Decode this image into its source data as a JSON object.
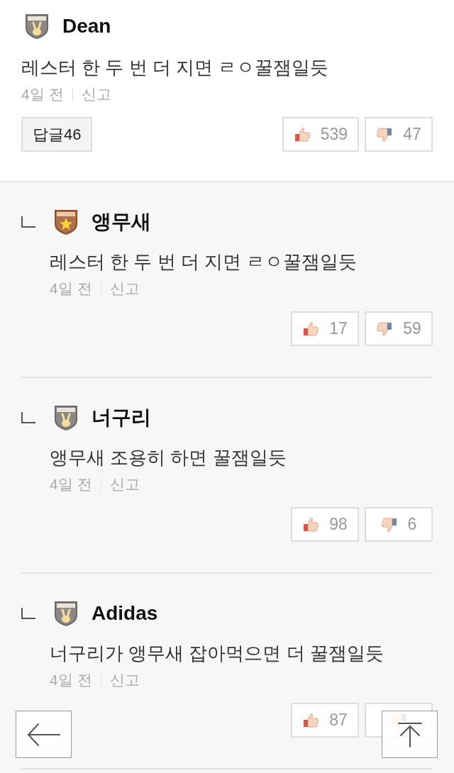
{
  "comment": {
    "kind": "rookie",
    "author": "Dean",
    "text": "레스터 한 두 번 더 지면 ㄹㅇ꿀잼일듯",
    "time": "4일 전",
    "report": "신고",
    "reply_button": "답글46",
    "likes": "539",
    "dislikes": "47"
  },
  "replies": [
    {
      "kind": "senior",
      "author": "앵무새",
      "text": "레스터 한 두 번 더 지면 ㄹㅇ꿀잼일듯",
      "time": "4일 전",
      "report": "신고",
      "likes": "17",
      "dislikes": "59"
    },
    {
      "kind": "rookie",
      "author": "너구리",
      "text": "앵무새 조용히 하면 꿀잼일듯",
      "time": "4일 전",
      "report": "신고",
      "likes": "98",
      "dislikes": "6"
    },
    {
      "kind": "rookie",
      "author": "Adidas",
      "text": "너구리가 앵무새 잡아먹으면 더 꿀잼일듯",
      "time": "4일 전",
      "report": "신고",
      "likes": "87"
    }
  ]
}
